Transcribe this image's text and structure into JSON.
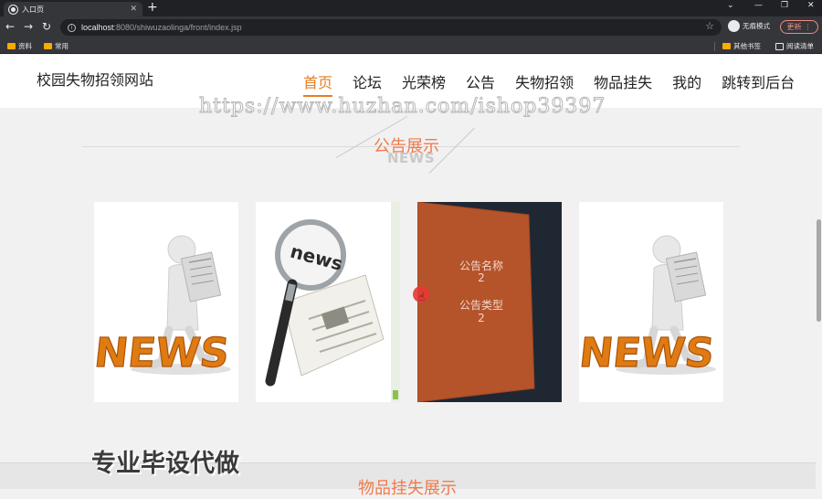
{
  "browser": {
    "tab_title": "入口页",
    "url_host": "localhost",
    "url_path": ":8080/shiwuzaolinga/front/index.jsp",
    "profile_label": "无痕模式",
    "update_label": "更新",
    "bookmarks": [
      "资料",
      "常用"
    ],
    "bookmarks_right": [
      "其他书签",
      "阅读清单"
    ]
  },
  "site": {
    "title": "校园失物招领网站",
    "nav": [
      "首页",
      "论坛",
      "光荣榜",
      "公告",
      "失物招领",
      "物品挂失",
      "我的",
      "跳转到后台"
    ],
    "active_nav": "首页"
  },
  "watermark": "https://www.huzhan.com/ishop39397",
  "announcements": {
    "title": "公告展示",
    "subtitle": "NEWS",
    "hover_card": {
      "name_label": "公告名称",
      "name_value": "2",
      "type_label": "公告类型",
      "type_value": "2"
    }
  },
  "promo_text": "专业毕设代做",
  "lost_items": {
    "title": "物品挂失展示"
  },
  "colors": {
    "accent": "#e67e22",
    "section_title": "#f07a4c",
    "card_overlay": "#b5532b"
  }
}
